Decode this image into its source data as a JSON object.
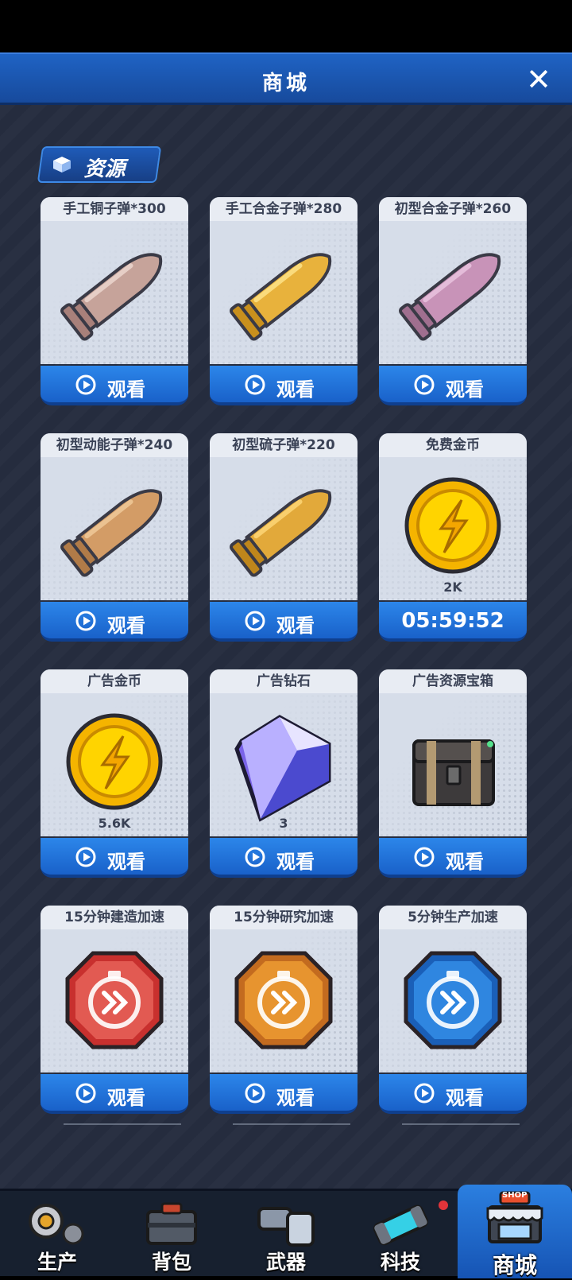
{
  "header": {
    "title": "商城"
  },
  "section": {
    "label": "资源"
  },
  "cards": [
    {
      "title": "手工铜子弹*300",
      "amount": "",
      "button": "观看",
      "art": "bullet-copper"
    },
    {
      "title": "手工合金子弹*280",
      "amount": "",
      "button": "观看",
      "art": "bullet-gold"
    },
    {
      "title": "初型合金子弹*260",
      "amount": "",
      "button": "观看",
      "art": "bullet-pink"
    },
    {
      "title": "初型动能子弹*240",
      "amount": "",
      "button": "观看",
      "art": "bullet-brass"
    },
    {
      "title": "初型硫子弹*220",
      "amount": "",
      "button": "观看",
      "art": "bullet-sulfur"
    },
    {
      "title": "免费金币",
      "amount": "2K",
      "button": "05:59:52",
      "art": "gold-coin"
    },
    {
      "title": "广告金币",
      "amount": "5.6K",
      "button": "观看",
      "art": "gold-coin"
    },
    {
      "title": "广告钻石",
      "amount": "3",
      "button": "观看",
      "art": "diamond"
    },
    {
      "title": "广告资源宝箱",
      "amount": "",
      "button": "观看",
      "art": "resource-chest"
    },
    {
      "title": "15分钟建造加速",
      "amount": "",
      "button": "观看",
      "art": "speedup-red"
    },
    {
      "title": "15分钟研究加速",
      "amount": "",
      "button": "观看",
      "art": "speedup-orange"
    },
    {
      "title": "5分钟生产加速",
      "amount": "",
      "button": "观看",
      "art": "speedup-blue"
    }
  ],
  "tabs": [
    {
      "label": "生产",
      "icon": "gear-icon"
    },
    {
      "label": "背包",
      "icon": "toolbox-icon"
    },
    {
      "label": "武器",
      "icon": "cannon-icon"
    },
    {
      "label": "科技",
      "icon": "battery-icon"
    },
    {
      "label": "商城",
      "icon": "shop-icon",
      "badge": "SHOP",
      "active": true
    }
  ],
  "colors": {
    "accent": "#1f63c4",
    "background": "#262d3f",
    "card": "#d6dde9",
    "button": "#2c86ea",
    "notification": "#e0343a"
  }
}
